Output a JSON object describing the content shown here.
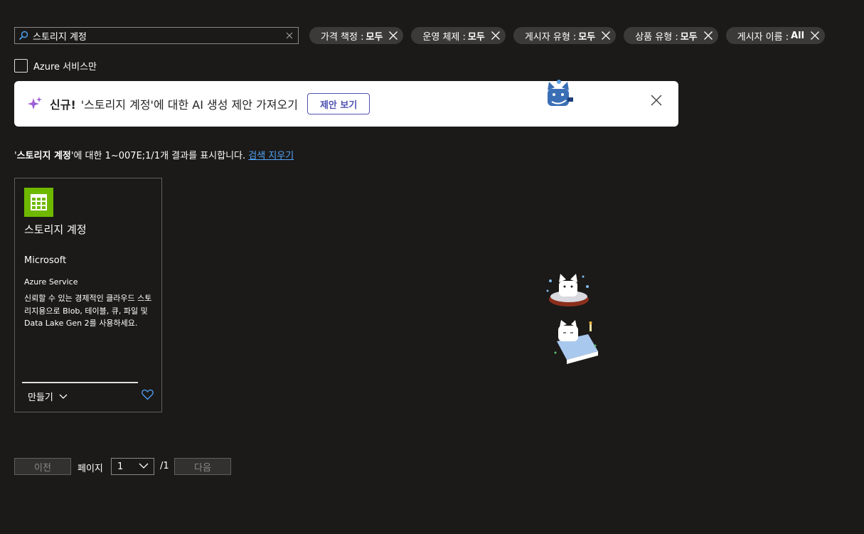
{
  "search": {
    "value": "스토리지 계정",
    "placeholder": ""
  },
  "filters": [
    {
      "label": "가격 책정 :",
      "value": "모두"
    },
    {
      "label": "운영 체제 :",
      "value": "모두"
    },
    {
      "label": "게시자 유형 :",
      "value": "모두"
    },
    {
      "label": "상품 유형 :",
      "value": "모두"
    },
    {
      "label": "게시자 이름 :",
      "value": "All"
    }
  ],
  "azure_only": {
    "label": "Azure 서비스만",
    "checked": false
  },
  "banner": {
    "new_label": "신규!",
    "message": "'스토리지 계정'에 대한 AI 생성 제안 가져오기",
    "button": "제안 보기"
  },
  "results": {
    "quote_open": "'",
    "query": "스토리지 계정",
    "text": "'에 대한 1~007E;1/1개 결과를 표시합니다.",
    "clear_link": "검색 지우기"
  },
  "card": {
    "title": "스토리지 계정",
    "publisher": "Microsoft",
    "type": "Azure Service",
    "description": "신뢰할 수 있는 경제적인 클라우드 스토리지용으로 Blob, 테이블, 큐, 파일 및 Data Lake Gen 2를 사용하세요.",
    "create_label": "만들기",
    "icon_color": "#6fb800"
  },
  "pagination": {
    "prev": "이전",
    "page_label": "페이지",
    "current": "1",
    "total": "/1",
    "next": "다음"
  },
  "colors": {
    "background": "#1b1a19",
    "pill_bg": "#3b3a39",
    "link": "#4fa3f7",
    "accent": "#4f52b2"
  }
}
